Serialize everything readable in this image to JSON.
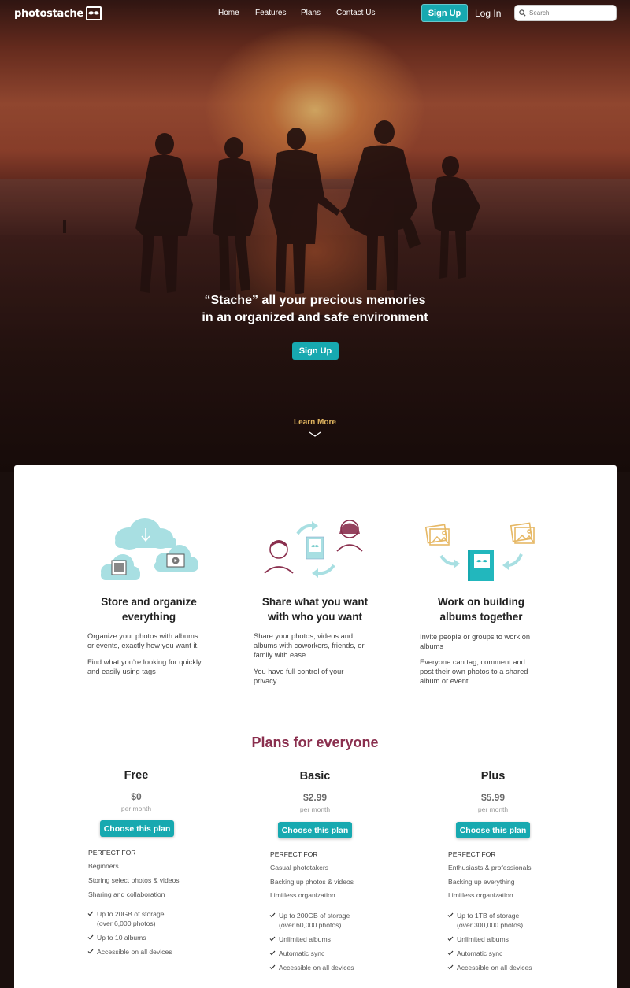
{
  "nav": {
    "logo_text": "photostache",
    "links": [
      "Home",
      "Features",
      "Plans",
      "Contact Us"
    ],
    "signup_label": "Sign Up",
    "login_label": "Log In",
    "search_placeholder": "Search"
  },
  "hero": {
    "title_line1": "“Stache” all your precious memories",
    "title_line2": "in an organized and safe environment",
    "signup_label": "Sign Up",
    "learn_more": "Learn More"
  },
  "features": [
    {
      "icon": "cloud-upload-icon",
      "title_line1": "Store and organize",
      "title_line2": "everything",
      "desc1_line1": "Organize your photos with albums",
      "desc1_line2": "or events, exactly how you want it.",
      "desc2_line1": "Find what you’re looking for quickly",
      "desc2_line2": "and easily using tags"
    },
    {
      "icon": "share-people-icon",
      "title_line1": "Share what you want",
      "title_line2": "with who you want",
      "desc1_line1": "Share your photos, videos and",
      "desc1_line2": "albums with coworkers, friends, or",
      "desc1_line3": "family with ease",
      "desc2_line1": "You have full control of your",
      "desc2_line2": "privacy"
    },
    {
      "icon": "album-collaborate-icon",
      "title_line1": "Work on building",
      "title_line2": "albums together",
      "desc1_line1": "Invite people or groups to work on",
      "desc1_line2": "albums",
      "desc2_line1": "Everyone can tag, comment and",
      "desc2_line2": "post their own photos to a shared",
      "desc2_line3": "album or event"
    }
  ],
  "plans_title": "Plans for everyone",
  "plans": [
    {
      "name": "Free",
      "price": "$0",
      "per": "per month",
      "button": "Choose this plan",
      "perfect_for": "PERFECT FOR",
      "for": [
        "Beginners",
        "Storing select photos & videos",
        "Sharing and collaboration"
      ],
      "feature1_line1": "Up to 20GB of storage",
      "feature1_line2": "(over 6,000 photos)",
      "features": [
        "Up to 10 albums",
        "Accessible on all devices"
      ]
    },
    {
      "name": "Basic",
      "price": "$2.99",
      "per": "per month",
      "button": "Choose this plan",
      "perfect_for": "PERFECT FOR",
      "for": [
        "Casual phototakers",
        "Backing up photos & videos",
        "Limitless organization"
      ],
      "feature1_line1": "Up to 200GB of storage",
      "feature1_line2": "(over 60,000 photos)",
      "features": [
        "Unlimited albums",
        "Automatic sync",
        "Accessible on all devices"
      ]
    },
    {
      "name": "Plus",
      "price": "$5.99",
      "per": "per month",
      "button": "Choose this plan",
      "perfect_for": "PERFECT FOR",
      "for": [
        "Enthusiasts & professionals",
        "Backing up everything",
        "Limitless organization"
      ],
      "feature1_line1": "Up to 1TB of storage",
      "feature1_line2": "(over 300,000 photos)",
      "features": [
        "Unlimited albums",
        "Automatic sync",
        "Accessible on all devices"
      ]
    }
  ],
  "colors": {
    "accent": "#17a9b0",
    "plans_title": "#8a2f4e",
    "learn_more": "#e0b45f",
    "icon_teal": "#a8dfe2",
    "icon_maroon": "#8a2f4e",
    "icon_gold": "#e6b865"
  }
}
